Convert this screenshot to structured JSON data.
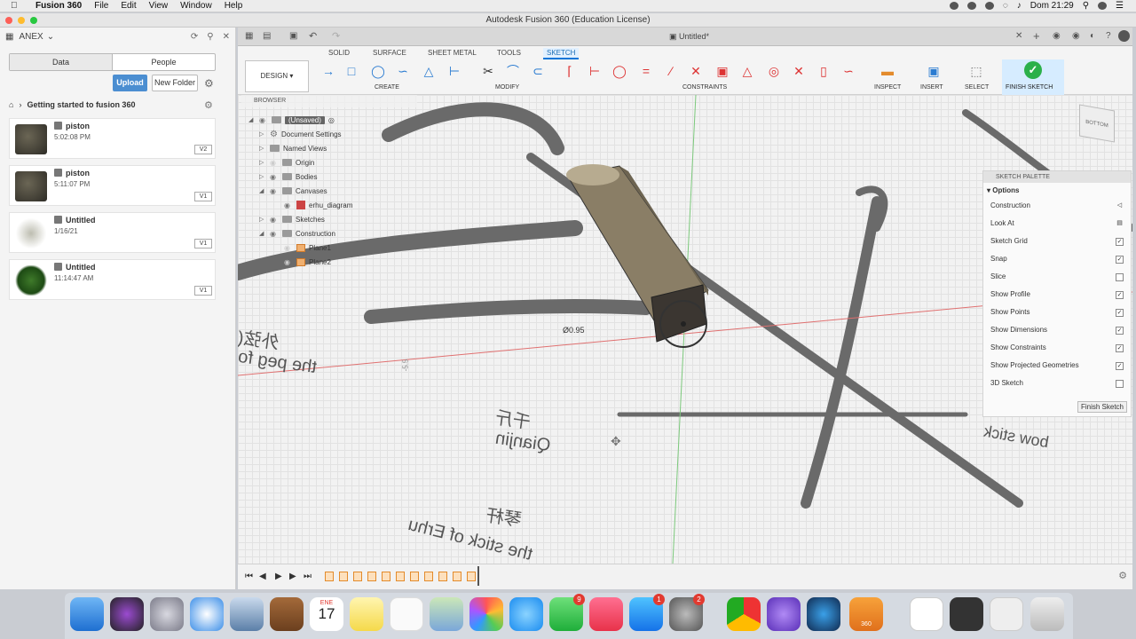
{
  "menubar": {
    "app": "Fusion 360",
    "menus": [
      "File",
      "Edit",
      "View",
      "Window",
      "Help"
    ],
    "clock": "Dom 21:29"
  },
  "window": {
    "title": "Autodesk Fusion 360 (Education License)"
  },
  "data_panel": {
    "team": "ANEX",
    "tabs": [
      "Data",
      "People"
    ],
    "upload": "Upload",
    "new_folder": "New Folder",
    "project": "Getting started to fusion 360",
    "files": [
      {
        "name": "piston",
        "time": "5:02:08 PM",
        "version": "V2"
      },
      {
        "name": "piston",
        "time": "5:11:07 PM",
        "version": "V1"
      },
      {
        "name": "Untitled",
        "time": "1/16/21",
        "version": "V1"
      },
      {
        "name": "Untitled",
        "time": "11:14:47 AM",
        "version": "V1"
      }
    ]
  },
  "document": {
    "tab_title": "Untitled*"
  },
  "toolbar": {
    "tabs": [
      "SOLID",
      "SURFACE",
      "SHEET METAL",
      "TOOLS",
      "SKETCH"
    ],
    "design": "DESIGN",
    "groups": {
      "create": "CREATE",
      "modify": "MODIFY",
      "constraints": "CONSTRAINTS",
      "inspect": "INSPECT",
      "insert": "INSERT",
      "select": "SELECT",
      "finish": "FINISH SKETCH"
    }
  },
  "browser": {
    "header": "BROWSER",
    "items": [
      "(Unsaved)",
      "Document Settings",
      "Named Views",
      "Origin",
      "Bodies",
      "Canvases",
      "erhu_diagram",
      "Sketches",
      "Construction",
      "Plane1",
      "Plane2"
    ]
  },
  "canvas": {
    "dimension": "Ø0.95",
    "coord": "-5.5",
    "texts": {
      "peg": "the peg fo",
      "qianjin": "Qianjin",
      "qianjin_cn": "千斤",
      "stick": "the stick of Erhu",
      "stick_cn": "琴杆",
      "bow": "bow stick",
      "cn1": "外弦("
    }
  },
  "sketch_palette": {
    "header": "SKETCH PALETTE",
    "section": "Options",
    "rows": [
      {
        "label": "Construction",
        "state": "icon"
      },
      {
        "label": "Look At",
        "state": "icon"
      },
      {
        "label": "Sketch Grid",
        "state": "checked"
      },
      {
        "label": "Snap",
        "state": "checked"
      },
      {
        "label": "Slice",
        "state": "unchecked"
      },
      {
        "label": "Show Profile",
        "state": "checked"
      },
      {
        "label": "Show Points",
        "state": "checked"
      },
      {
        "label": "Show Dimensions",
        "state": "checked"
      },
      {
        "label": "Show Constraints",
        "state": "checked"
      },
      {
        "label": "Show Projected Geometries",
        "state": "checked"
      },
      {
        "label": "3D Sketch",
        "state": "unchecked"
      }
    ],
    "finish_button": "Finish Sketch"
  },
  "viewcube": {
    "face": "BOTTOM"
  },
  "dock": {
    "calendar_month": "ENE",
    "calendar_day": "17",
    "badges": {
      "facetime": "9",
      "appstore": "1",
      "settings": "2"
    },
    "fusion_label": "360"
  }
}
